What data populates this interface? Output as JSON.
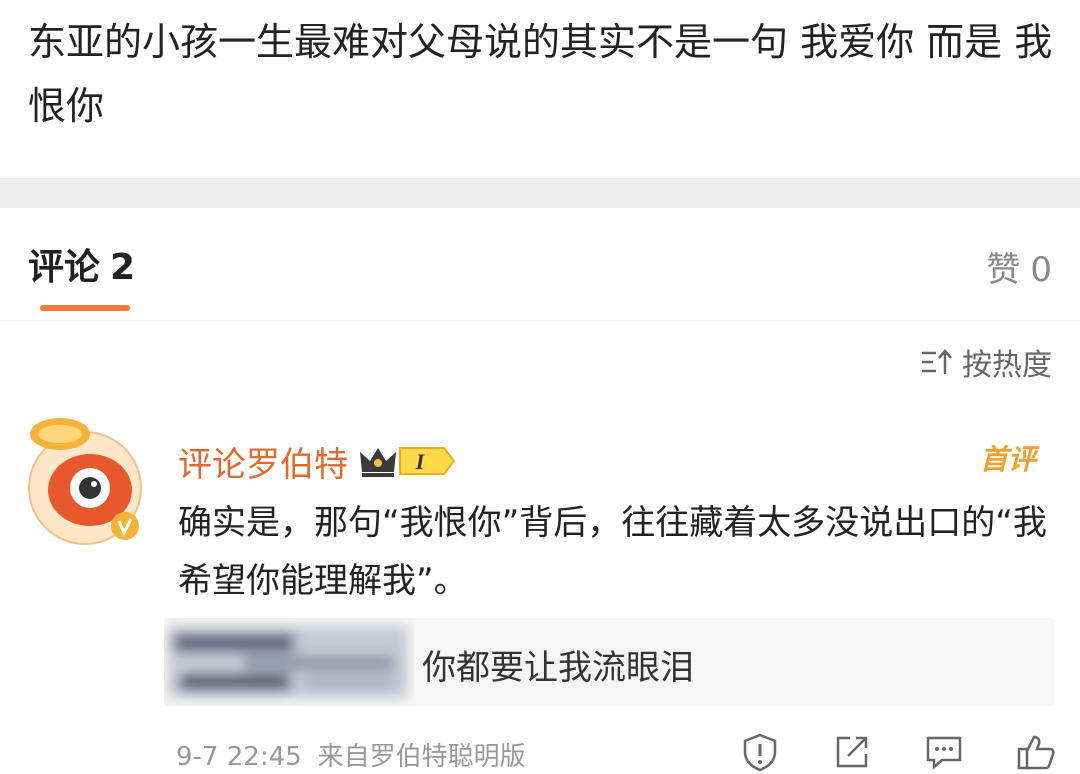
{
  "post": {
    "text": "东亚的小孩一生最难对父母说的其实不是一句 我爱你 而是 我恨你"
  },
  "tabs": {
    "comments_label": "评论",
    "comments_count": "2",
    "likes_label": "赞",
    "likes_count": "0"
  },
  "sort": {
    "label": "按热度",
    "icon": "sort-icon"
  },
  "comment": {
    "username": "评论罗伯特",
    "level_badge": "I",
    "first_badge": "首评",
    "text": "确实是，那句“我恨你”背后，往往藏着太多没说出口的“我希望你能理解我”。",
    "reply_text": "你都要让我流眼泪",
    "time": "9-7 22:45",
    "source": "来自罗伯特聪明版",
    "icons": [
      "report-icon",
      "share-icon",
      "reply-icon",
      "like-icon"
    ]
  },
  "colors": {
    "accent": "#f27a3c",
    "username": "#e06a2e",
    "first_badge": "#f0a030",
    "muted": "#999999"
  }
}
